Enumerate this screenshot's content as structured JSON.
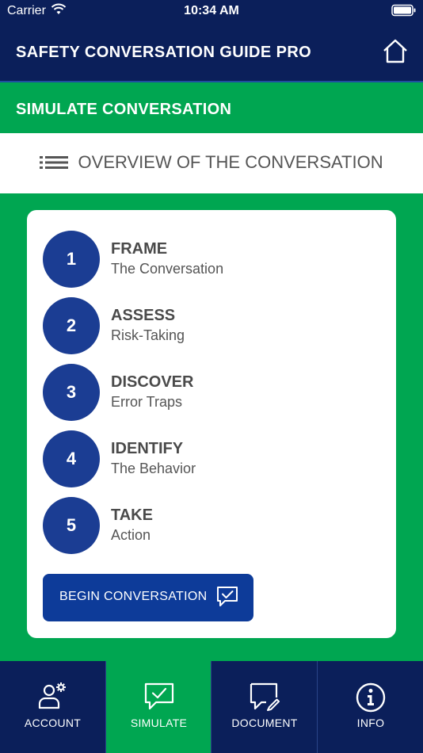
{
  "status_bar": {
    "carrier": "Carrier",
    "time": "10:34 AM"
  },
  "header": {
    "title": "SAFETY CONVERSATION GUIDE PRO",
    "home_icon": "home-icon"
  },
  "section": {
    "title": "SIMULATE CONVERSATION"
  },
  "overview": {
    "title": "OVERVIEW OF THE CONVERSATION",
    "icon": "list-icon"
  },
  "steps": [
    {
      "number": "1",
      "title": "FRAME",
      "subtitle": "The Conversation"
    },
    {
      "number": "2",
      "title": "ASSESS",
      "subtitle": "Risk-Taking"
    },
    {
      "number": "3",
      "title": "DISCOVER",
      "subtitle": "Error Traps"
    },
    {
      "number": "4",
      "title": "IDENTIFY",
      "subtitle": "The Behavior"
    },
    {
      "number": "5",
      "title": "TAKE",
      "subtitle": "Action"
    }
  ],
  "begin_button": {
    "label": "BEGIN CONVERSATION",
    "icon": "chat-check-icon"
  },
  "tabs": [
    {
      "label": "ACCOUNT",
      "icon": "account-settings-icon",
      "active": false
    },
    {
      "label": "SIMULATE",
      "icon": "chat-check-icon",
      "active": true
    },
    {
      "label": "DOCUMENT",
      "icon": "chat-edit-icon",
      "active": false
    },
    {
      "label": "INFO",
      "icon": "info-icon",
      "active": false
    }
  ],
  "colors": {
    "navy": "#0b1f5a",
    "green": "#00a651",
    "step_blue": "#1b3d93",
    "button_blue": "#0d3b99"
  }
}
